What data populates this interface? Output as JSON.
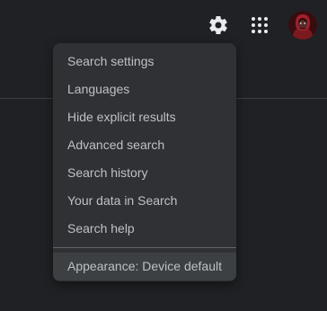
{
  "header": {
    "settings_icon": "gear-icon",
    "apps_icon": "apps-grid-icon",
    "avatar_icon": "user-avatar"
  },
  "settings_menu": {
    "items": [
      {
        "label": "Search settings"
      },
      {
        "label": "Languages"
      },
      {
        "label": "Hide explicit results"
      },
      {
        "label": "Advanced search"
      },
      {
        "label": "Search history"
      },
      {
        "label": "Your data in Search"
      },
      {
        "label": "Search help"
      }
    ],
    "appearance_label": "Appearance: Device default"
  },
  "colors": {
    "background": "#202124",
    "menu_background": "#303134",
    "menu_text": "#bdc1c6",
    "highlight_background": "#3c4043",
    "icon_color": "#e8eaed"
  }
}
